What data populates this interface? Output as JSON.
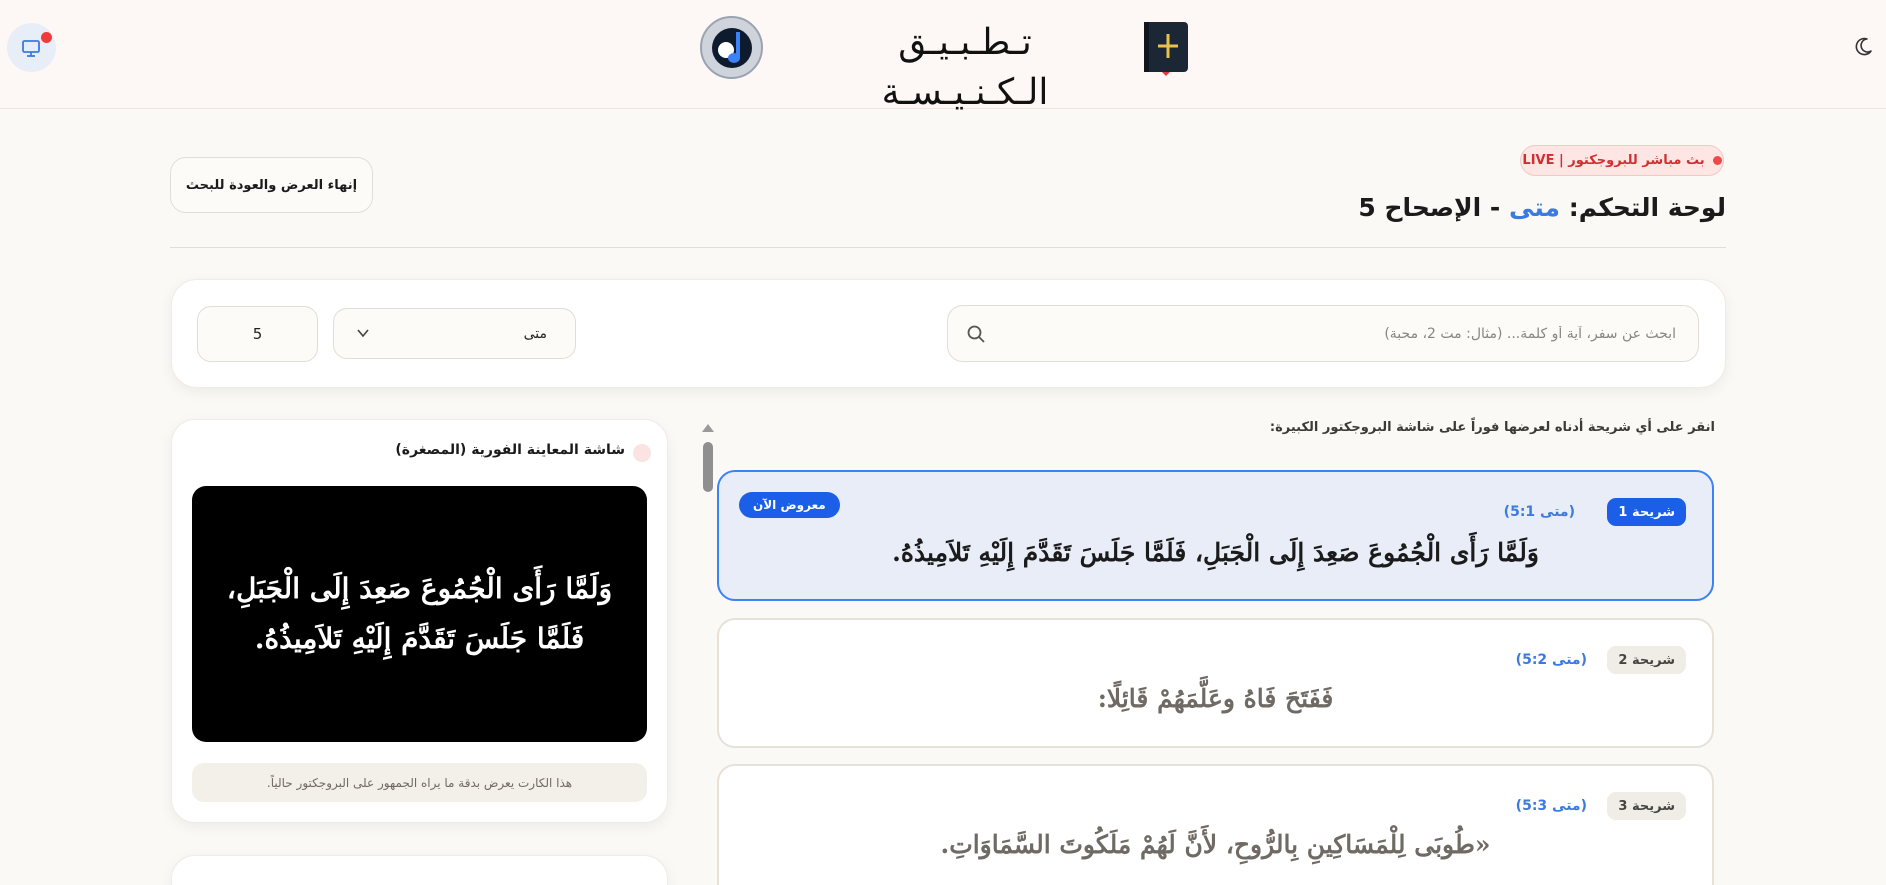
{
  "header": {
    "app_title": "تـطـبـيـق الـكـنـيـسـة"
  },
  "status": {
    "live_badge": "بث مباشر للبروجكتور | LIVE"
  },
  "panel": {
    "title_prefix": "لوحة التحكم:",
    "book": "متى",
    "separator": "-",
    "chapter_label": "الإصحاح 5"
  },
  "actions": {
    "end_button": "إنهاء العرض والعودة للبحث"
  },
  "search": {
    "placeholder": "ابحث عن سفر، آية أو كلمة... (مثال: مت 2، محبة)",
    "value": "",
    "book_selected": "متى",
    "chapter_value": "5"
  },
  "preview": {
    "title": "شاشة المعاينة الفورية (المصغرة)",
    "screen_text": "وَلَمَّا رَأَى الْجُمُوعَ صَعِدَ إِلَى الْجَبَلِ، فَلَمَّا جَلَسَ تَقَدَّمَ إِلَيْهِ تَلاَمِيذُهُ.",
    "note": "هذا الكارت يعرض بدقة ما يراه الجمهور على البروجكتور حالياً."
  },
  "slides": {
    "hint": "انقر على أي شريحة أدناه لعرضها فوراً على شاشة البروجكتور الكبيرة:",
    "now_showing": "معروض الآن",
    "items": [
      {
        "tag": "شريحة 1",
        "ref": "(متى 5:1)",
        "text": "وَلَمَّا رَأَى الْجُمُوعَ صَعِدَ إِلَى الْجَبَلِ، فَلَمَّا جَلَسَ تَقَدَّمَ إِلَيْهِ تَلاَمِيذُهُ.",
        "active": true
      },
      {
        "tag": "شريحة 2",
        "ref": "(متى 5:2)",
        "text": "فَفَتَحَ فَاهُ وعَلَّمَهُمْ قَائِلًا:",
        "active": false
      },
      {
        "tag": "شريحة 3",
        "ref": "(متى 5:3)",
        "text": "«طُوبَى لِلْمَسَاكِينِ بِالرُّوحِ، لأَنَّ لَهُمْ مَلَكُوتَ السَّمَاوَاتِ.",
        "active": false
      }
    ]
  },
  "colors": {
    "accent": "#3b82f6",
    "live": "#d12f2f",
    "active_tag": "#1b5fe8"
  },
  "icons": {
    "projector": "projector-icon",
    "logo": "music-note-icon",
    "bible": "bible-icon",
    "theme": "moon-icon",
    "search": "search-icon",
    "select": "chevron-down-icon"
  }
}
